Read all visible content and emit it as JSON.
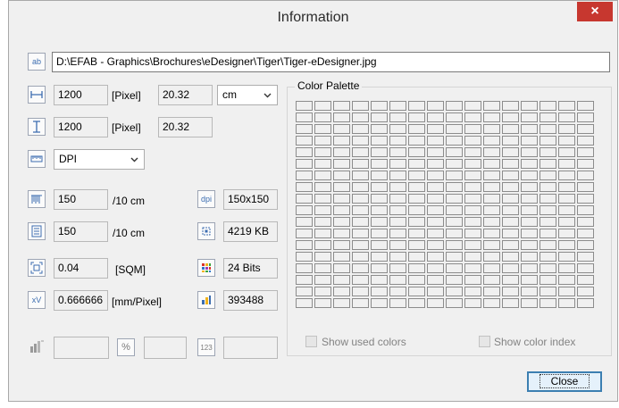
{
  "window": {
    "title": "Information",
    "close_glyph": "×"
  },
  "file_path": {
    "value": "D:\\EFAB - Graphics\\Brochures\\eDesigner\\Tiger\\Tiger-eDesigner.jpg",
    "icon_text": "ab"
  },
  "width": {
    "pixels": "1200",
    "unit": "[Pixel]",
    "converted": "20.32"
  },
  "height": {
    "pixels": "1200",
    "unit": "[Pixel]",
    "converted": "20.32"
  },
  "unit_select": {
    "selected": "cm"
  },
  "resolution_mode": {
    "selected": "DPI"
  },
  "horizontal_resolution": {
    "value": "150",
    "unit": "/10 cm"
  },
  "vertical_resolution": {
    "value": "150",
    "unit": "/10 cm"
  },
  "dpi": {
    "icon_text": "dpi",
    "value": "150x150"
  },
  "file_size": {
    "value": "4219 KB"
  },
  "area": {
    "value": "0.04",
    "unit": "[SQM]"
  },
  "scale": {
    "icon_text": "xV",
    "value": "0.666666",
    "unit": "[mm/Pixel]"
  },
  "bit_depth": {
    "value": "24 Bits"
  },
  "colors_count": {
    "value": "393488"
  },
  "bottom_fields": {
    "percent_icon": "%",
    "number_icon": "123"
  },
  "color_palette": {
    "title": "Color Palette",
    "show_used_colors": "Show used colors",
    "show_color_index": "Show color index"
  },
  "buttons": {
    "close": "Close"
  },
  "colors": {
    "close_red": "#c7372f",
    "focus_blue": "#3c7fb1"
  }
}
